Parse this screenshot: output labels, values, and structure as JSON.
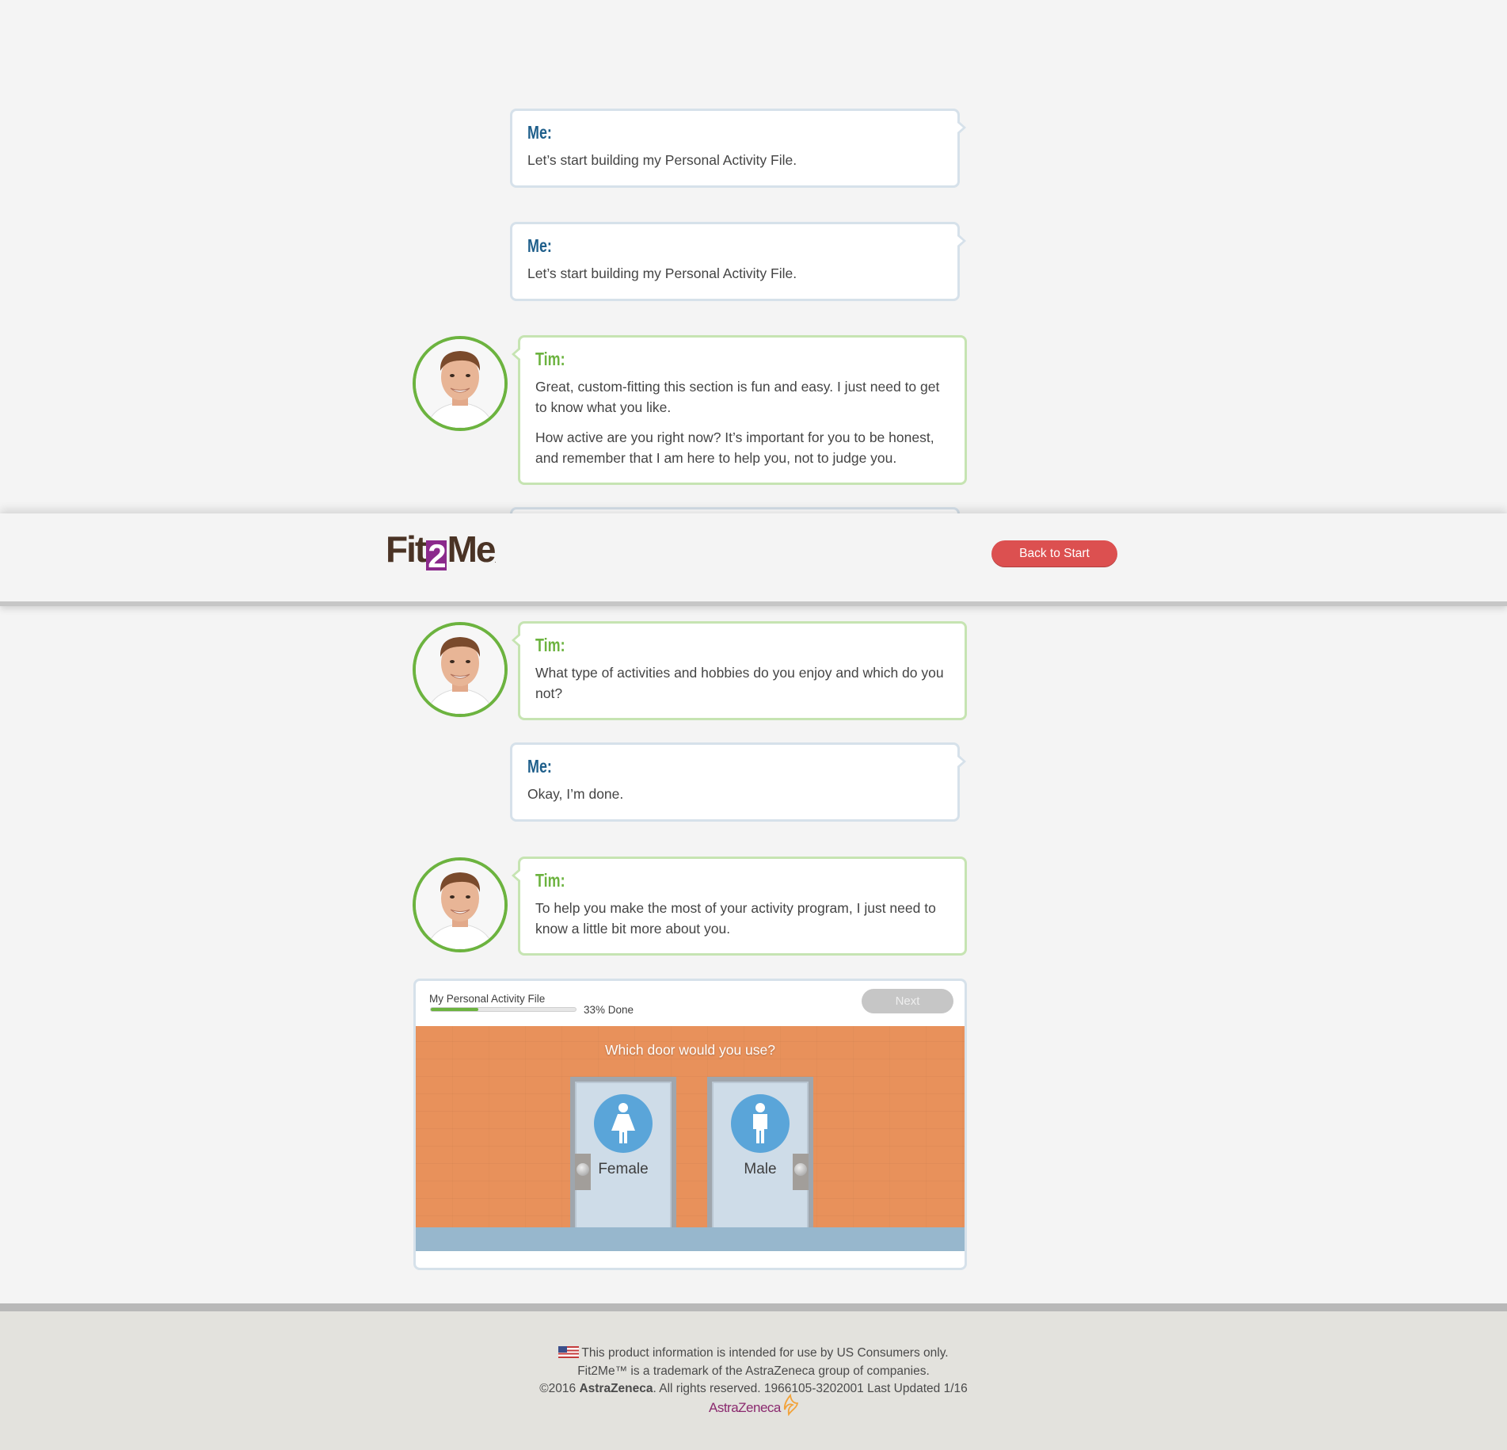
{
  "conversation": {
    "me1": {
      "speaker": "Me:",
      "text": "Let’s start building my Personal Activity File."
    },
    "me2": {
      "speaker": "Me:",
      "text": "Let’s start building my Personal Activity File."
    },
    "tim1": {
      "speaker": "Tim:",
      "p1": "Great, custom-fitting this section is fun and easy. I just need to get to know what you like.",
      "p2": "How active are you right now? It’s important for you to be honest, and remember that I am here to help you, not to judge you."
    },
    "tim2": {
      "speaker": "Tim:",
      "text": "What type of activities and hobbies do you enjoy and which do you not?"
    },
    "me3": {
      "speaker": "Me:",
      "text": "Okay, I’m done."
    },
    "tim3": {
      "speaker": "Tim:",
      "text": "To help you make the most of your activity program, I just need to know a little bit more about you."
    }
  },
  "header": {
    "logo_prefix": "Fit",
    "logo_two": "2",
    "logo_suffix": "Me",
    "logo_mark": ".",
    "back_label": "Back to Start"
  },
  "activity_file": {
    "title": "My Personal Activity File",
    "progress_percent": 33,
    "progress_label": "33% Done",
    "next_label": "Next",
    "question": "Which door would you use?",
    "doors": [
      {
        "label": "Female",
        "icon": "female-icon"
      },
      {
        "label": "Male",
        "icon": "male-icon"
      }
    ]
  },
  "footer": {
    "line1": "This product information is intended for use by US Consumers only.",
    "line2": "Fit2Me™ is a trademark of the AstraZeneca group of companies.",
    "line3_prefix": "©2016 ",
    "line3_company": "AstraZeneca",
    "line3_suffix": ". All rights reserved. 1966105-3202001 Last Updated 1/16",
    "brand_logo_text": "AstraZeneca"
  },
  "colors": {
    "me_accent": "#1f5f8b",
    "tim_accent": "#6cb33f",
    "back_button": "#dc5050",
    "logo_purple": "#8b2a8c",
    "door_scene": "#e8915b"
  }
}
